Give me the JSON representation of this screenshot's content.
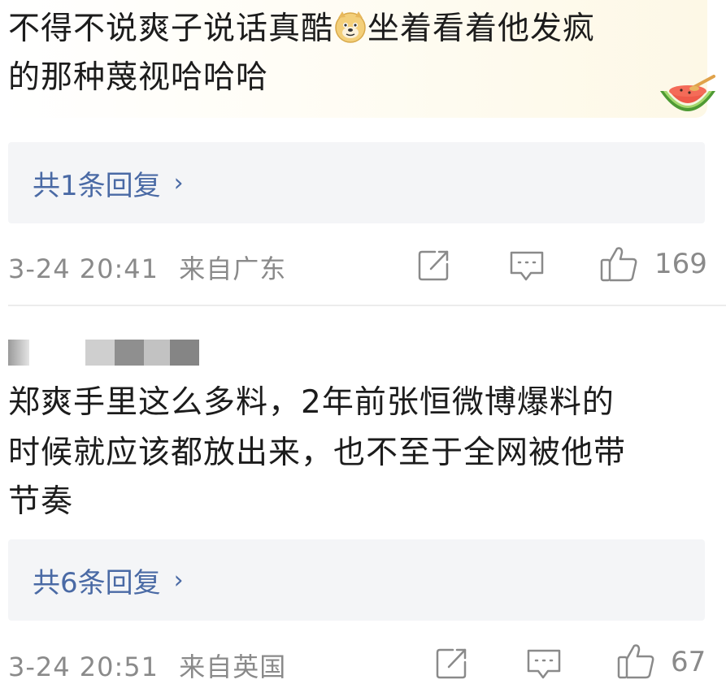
{
  "comment1": {
    "text_line1_before": "不得不说爽子说话真酷",
    "emoji": "doge-emoji",
    "text_line1_after": "坐着看着他发疯",
    "text_line2": "的那种蔑视哈哈哈",
    "badge_icon": "watermelon-icon",
    "replies": {
      "label": "共1条回复",
      "chevron": "›"
    },
    "timestamp": "3-24 20:41",
    "location": "来自广东",
    "likes": "169"
  },
  "comment2": {
    "username": "",
    "text_line1": "郑爽手里这么多料，2年前张恒微博爆料的",
    "text_line2": "时候就应该都放出来，也不至于全网被他带",
    "text_line3": "节奏",
    "replies": {
      "label": "共6条回复",
      "chevron": "›"
    },
    "timestamp": "3-24 20:51",
    "location": "来自英国",
    "likes": "67"
  },
  "colors": {
    "link": "#4a6aa5",
    "meta": "#8a8a8a",
    "reply_bg": "#f4f5f7"
  }
}
